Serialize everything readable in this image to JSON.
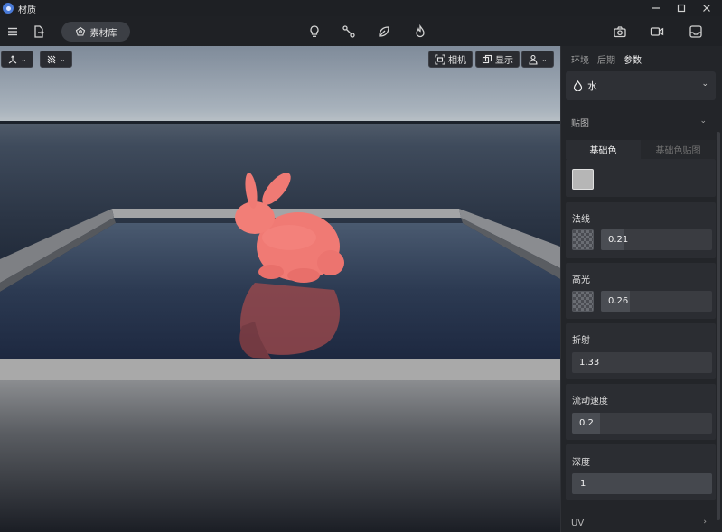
{
  "app": {
    "title": "材质"
  },
  "toolbar": {
    "library_label": "素材库"
  },
  "viewport": {
    "camera_label": "相机",
    "display_label": "显示",
    "scene_object": "pink bunny"
  },
  "panel": {
    "tabs": [
      {
        "label": "环境",
        "active": false
      },
      {
        "label": "后期",
        "active": false
      },
      {
        "label": "参数",
        "active": true
      }
    ],
    "material": {
      "name": "水"
    },
    "texture_section": {
      "title": "贴图"
    },
    "subtabs": [
      {
        "label": "基础色",
        "active": true
      },
      {
        "label": "基础色贴图",
        "active": false
      }
    ],
    "base_color": "#b6b6b6",
    "normal": {
      "label": "法线",
      "value": "0.21",
      "fraction": 0.21
    },
    "specular": {
      "label": "高光",
      "value": "0.26",
      "fraction": 0.26
    },
    "refraction": {
      "label": "折射",
      "value": "1.33",
      "fraction": 0.0
    },
    "flow_speed": {
      "label": "流动速度",
      "value": "0.2",
      "fraction": 0.2
    },
    "depth": {
      "label": "深度",
      "value": "1",
      "fraction": 1.0
    },
    "uv_section": {
      "title": "UV"
    }
  },
  "colors": {
    "accent_panel": "#2b2d32",
    "bunny": "#f07a74"
  }
}
